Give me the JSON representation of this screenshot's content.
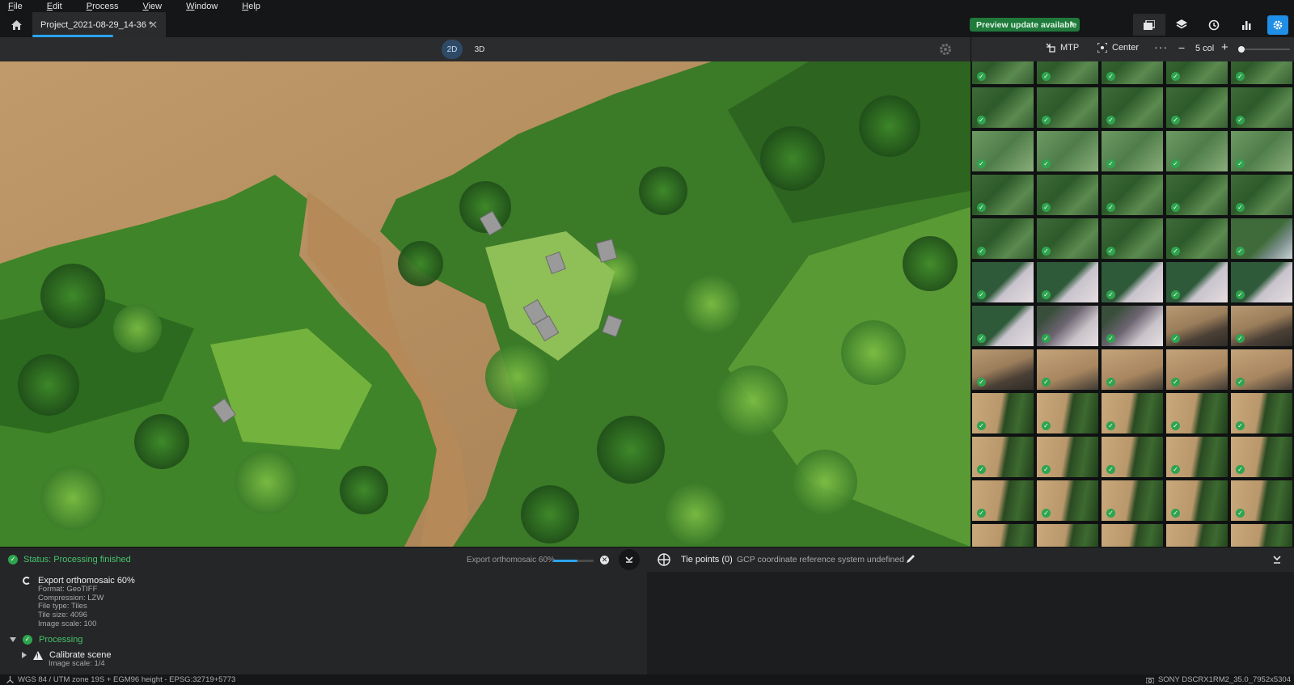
{
  "menu": [
    "File",
    "Edit",
    "Process",
    "View",
    "Window",
    "Help"
  ],
  "tab": {
    "title": "Project_2021-08-29_14-36 *"
  },
  "preview": {
    "label": "Preview update available"
  },
  "view_modes": {
    "d2": "2D",
    "d3": "3D",
    "active": "2D"
  },
  "grid_toolbar": {
    "mtp": "MTP",
    "center": "Center",
    "more": "···",
    "minus": "−",
    "plus": "+",
    "columns": "5 col"
  },
  "thumbnails": {
    "check_glyph": "✓",
    "rows": [
      [
        "forest",
        "forest",
        "forest",
        "forest",
        "forest"
      ],
      [
        "forest",
        "forest",
        "forest",
        "forest",
        "forest"
      ],
      [
        "forest-light",
        "forest-light",
        "forest-light",
        "forest-light",
        "forest-light"
      ],
      [
        "forest",
        "forest",
        "forest",
        "forest",
        "forest"
      ],
      [
        "forest",
        "forest",
        "forest",
        "forest",
        "forest-river"
      ],
      [
        "forest-sky",
        "forest-sky",
        "forest-sky",
        "forest-sky",
        "forest-sky"
      ],
      [
        "forest-sky",
        "sky",
        "sky",
        "river-forest",
        "river-forest"
      ],
      [
        "river-forest",
        "river",
        "river",
        "river",
        "river"
      ],
      [
        "river-trees",
        "river-trees",
        "river-trees",
        "river-trees",
        "river-trees"
      ],
      [
        "river-trees",
        "river-trees",
        "river-trees",
        "river-trees",
        "river-trees"
      ],
      [
        "river-trees",
        "river-trees",
        "river-trees",
        "river-trees",
        "river-trees"
      ],
      [
        "river-trees",
        "river-trees",
        "river-trees",
        "river-trees",
        "river-trees"
      ]
    ]
  },
  "status": {
    "text": "Status: Processing finished"
  },
  "export": {
    "status": "Export orthomosaic 60%",
    "progress": 0.6
  },
  "tasks": {
    "export": {
      "title": "Export orthomosaic 60%",
      "details": [
        "Format: GeoTIFF",
        "Compression: LZW",
        "File type: Tiles",
        "Tile size: 4096",
        "Image scale: 100"
      ]
    },
    "processing": {
      "title": "Processing"
    },
    "calibrate": {
      "title": "Calibrate scene",
      "details": [
        "Image scale: 1/4"
      ]
    }
  },
  "gcp": {
    "tie_points": "Tie points (0)",
    "crs": "GCP coordinate reference system undefined"
  },
  "statusbar": {
    "crs": "WGS 84 / UTM zone 19S + EGM96 height - EPSG:32719+5773",
    "camera": "SONY DSCRX1RM2_35.0_7952x5304"
  },
  "colors": {
    "accent": "#2aa3ee",
    "success": "#2ea44f",
    "preview": "#1f7a3c",
    "settings": "#1f8ee6"
  }
}
